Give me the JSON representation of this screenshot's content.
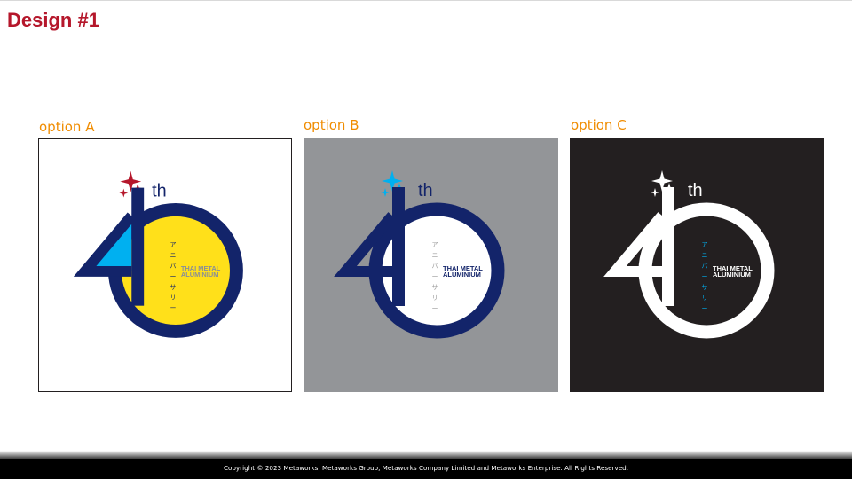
{
  "slide": {
    "title": "Design #1",
    "footer": "Copyright © 2023 Metaworks, Metaworks Group, Metaworks Company Limited and Metaworks Enterprise. All Rights Reserved."
  },
  "colors": {
    "title": "#b5172b",
    "option_label": "#f08c00",
    "navy": "#13246a",
    "yellow": "#ffe01a",
    "cyan": "#00b0f0",
    "red_sparkle": "#b5172b",
    "gray_panel": "#939598",
    "black_panel": "#231f20"
  },
  "options": [
    {
      "label": "option A",
      "emblem": {
        "suffix": "th",
        "katakana": [
          "ア",
          "ニ",
          "バ",
          "ー",
          "サ",
          "リ",
          "ー"
        ],
        "brand_line1": "THAI METAL",
        "brand_line2": "ALUMINIUM"
      }
    },
    {
      "label": "option B",
      "emblem": {
        "suffix": "th",
        "katakana": [
          "ア",
          "ニ",
          "バ",
          "ー",
          "サ",
          "リ",
          "ー"
        ],
        "brand_line1": "THAI METAL",
        "brand_line2": "ALUMINIUM"
      }
    },
    {
      "label": "option C",
      "emblem": {
        "suffix": "th",
        "katakana": [
          "ア",
          "ニ",
          "バ",
          "ー",
          "サ",
          "リ",
          "ー"
        ],
        "brand_line1": "THAI METAL",
        "brand_line2": "ALUMINIUM"
      }
    }
  ]
}
